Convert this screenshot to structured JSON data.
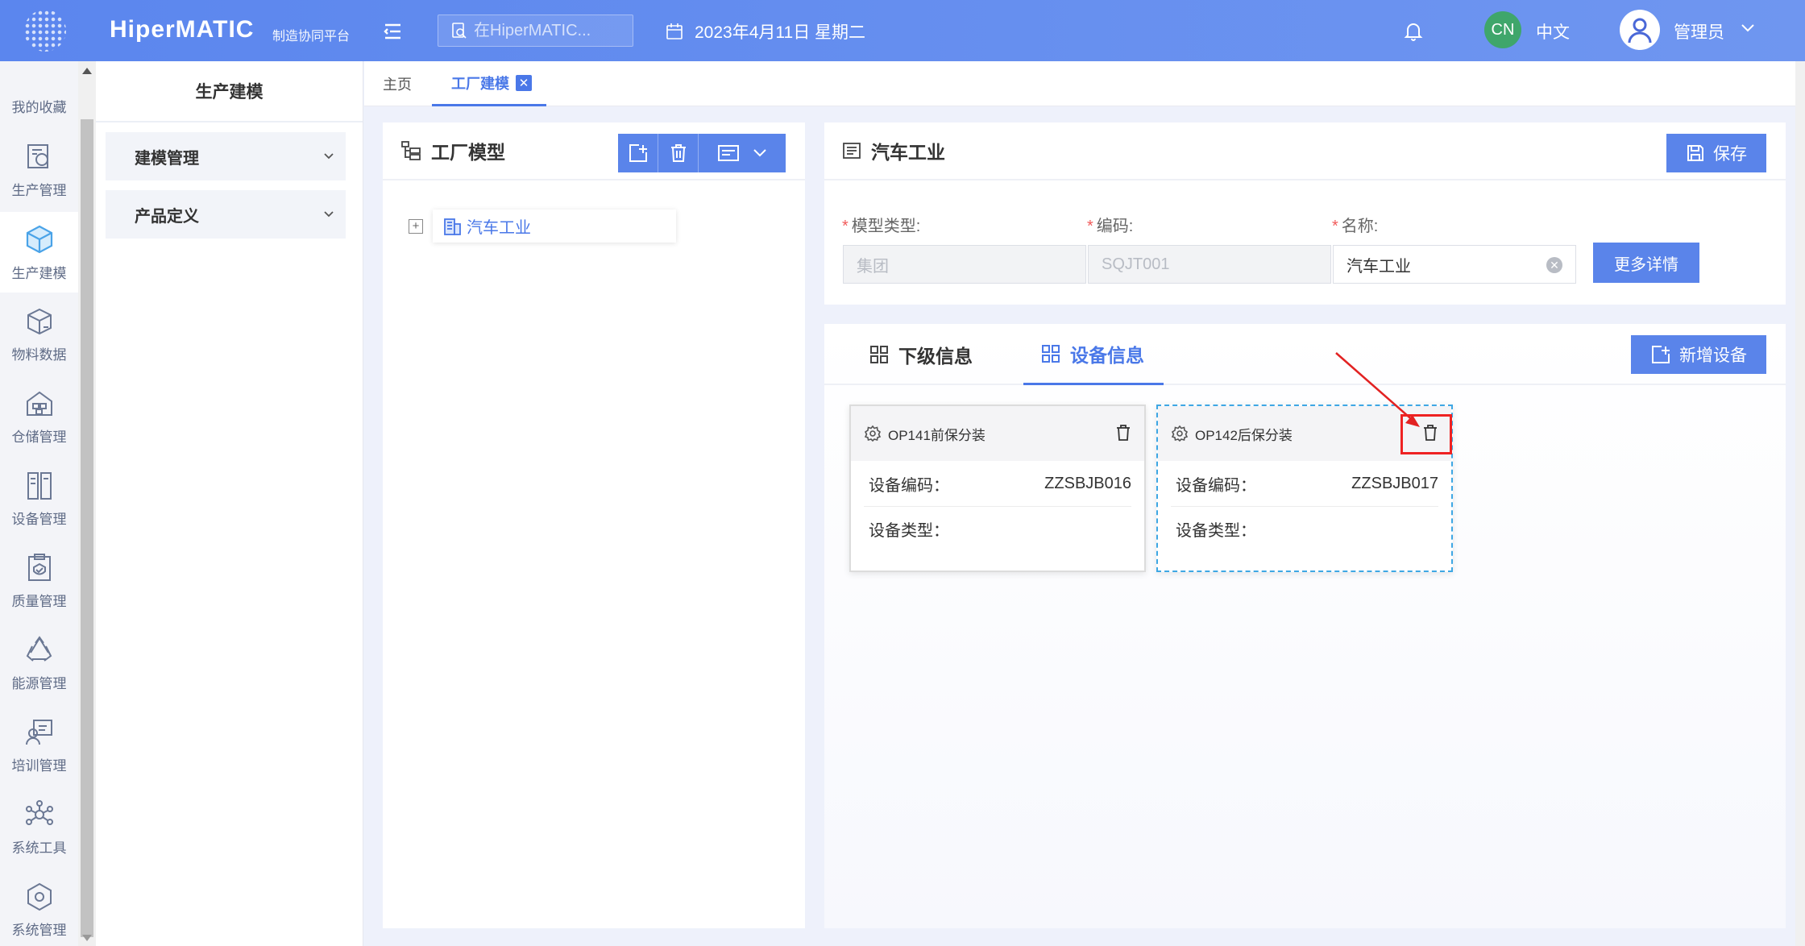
{
  "header": {
    "brand": "HiperMATIC",
    "brand_sub": "制造协同平台",
    "search_placeholder": "在HiperMATIC...",
    "date": "2023年4月11日 星期二",
    "lang_badge": "CN",
    "lang_label": "中文",
    "user_name": "管理员"
  },
  "rail": {
    "items": [
      {
        "label": "我的收藏",
        "icon": "star-icon"
      },
      {
        "label": "生产管理",
        "icon": "production-icon"
      },
      {
        "label": "生产建模",
        "icon": "cube-icon"
      },
      {
        "label": "物料数据",
        "icon": "material-icon"
      },
      {
        "label": "仓储管理",
        "icon": "warehouse-icon"
      },
      {
        "label": "设备管理",
        "icon": "equipment-icon"
      },
      {
        "label": "质量管理",
        "icon": "quality-icon"
      },
      {
        "label": "能源管理",
        "icon": "energy-icon"
      },
      {
        "label": "培训管理",
        "icon": "training-icon"
      },
      {
        "label": "系统工具",
        "icon": "tools-icon"
      },
      {
        "label": "系统管理",
        "icon": "settings-icon"
      }
    ]
  },
  "submenu": {
    "title": "生产建模",
    "groups": [
      "建模管理",
      "产品定义"
    ]
  },
  "tabs": {
    "home": "主页",
    "active": "工厂建模"
  },
  "tree": {
    "title": "工厂模型",
    "node": "汽车工业"
  },
  "detail": {
    "title": "汽车工业",
    "save": "保存",
    "fields": [
      {
        "label": "模型类型:",
        "value": "集团"
      },
      {
        "label": "编码:",
        "value": "SQJT001"
      },
      {
        "label": "名称:",
        "value": "汽车工业"
      }
    ],
    "more": "更多详情"
  },
  "devices": {
    "tabs": [
      "下级信息",
      "设备信息"
    ],
    "add": "新增设备",
    "code_label": "设备编码：",
    "type_label": "设备类型：",
    "cards": [
      {
        "name": "OP141前保分装",
        "code": "ZZSBJB016",
        "type": ""
      },
      {
        "name": "OP142后保分装",
        "code": "ZZSBJB017",
        "type": ""
      }
    ]
  },
  "colors": {
    "primary": "#5a84ea",
    "accent_text": "#4a78e8",
    "required": "#f15b5b",
    "annotation": "#e22222"
  }
}
